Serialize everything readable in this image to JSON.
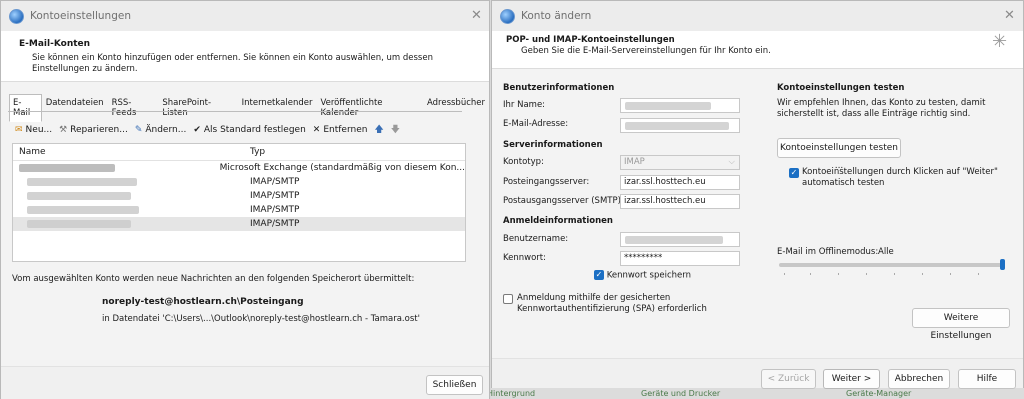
{
  "account_settings": {
    "title": "Kontoeinstellungen",
    "header_title": "E-Mail-Konten",
    "header_desc": "Sie können ein Konto hinzufügen oder entfernen. Sie können ein Konto auswählen, um dessen Einstellungen zu ändern.",
    "tabs": [
      "E-Mail",
      "Datendateien",
      "RSS-Feeds",
      "SharePoint-Listen",
      "Internetkalender",
      "Veröffentlichte Kalender",
      "Adressbücher"
    ],
    "toolbar": {
      "new": "Neu...",
      "repair": "Reparieren...",
      "change": "Ändern...",
      "default": "Als Standard festlegen",
      "remove": "Entfernen"
    },
    "list_headers": {
      "name": "Name",
      "type": "Typ"
    },
    "accounts": [
      {
        "type": "Microsoft Exchange (standardmäßig von diesem Kon..."
      },
      {
        "type": "IMAP/SMTP"
      },
      {
        "type": "IMAP/SMTP"
      },
      {
        "type": "IMAP/SMTP"
      },
      {
        "type": "IMAP/SMTP"
      }
    ],
    "delivery_text": "Vom ausgewählten Konto werden neue Nachrichten an den folgenden Speicherort übermittelt:",
    "delivery_folder": "noreply-test@hostlearn.ch\\Posteingang",
    "delivery_file": "in Datendatei 'C:\\Users\\...\\Outlook\\noreply-test@hostlearn.ch - Tamara.ost'",
    "close_button": "Schließen"
  },
  "change_account": {
    "title": "Konto ändern",
    "header_title": "POP- und IMAP-Kontoeinstellungen",
    "header_desc": "Geben Sie die E-Mail-Servereinstellungen für Ihr Konto ein.",
    "user_info_heading": "Benutzerinformationen",
    "name_label": "Ihr Name:",
    "email_label": "E-Mail-Adresse:",
    "server_info_heading": "Serverinformationen",
    "account_type_label": "Kontotyp:",
    "account_type_value": "IMAP",
    "incoming_label": "Posteingangsserver:",
    "incoming_value": "izar.ssl.hosttech.eu",
    "outgoing_label": "Postausgangsserver (SMTP):",
    "outgoing_value": "izar.ssl.hosttech.eu",
    "login_heading": "Anmeldeinformationen",
    "username_label": "Benutzername:",
    "password_label": "Kennwort:",
    "password_value": "*********",
    "save_password_label": "Kennwort speichern",
    "spa_label_line1": "Anmeldung mithilfe der gesicherten",
    "spa_label_line2": "Kennwortauthentifizierung (SPA) erforderlich",
    "test_heading": "Kontoeinstellungen testen",
    "test_desc": "Wir empfehlen Ihnen, das Konto zu testen, damit sicherstellt ist, dass alle Einträge richtig sind.",
    "test_button": "Kontoeinstellungen testen ...",
    "auto_test_line1": "Kontoeinstellungen durch Klicken auf \"Weiter\"",
    "auto_test_line2": "automatisch testen",
    "offline_label": "E-Mail im Offlinemodus:",
    "offline_value": "Alle",
    "offline_slider_fraction": 1.0,
    "more_settings_button": "Weitere Einstellungen",
    "back_button": "< Zurück",
    "next_button": "Weiter >",
    "cancel_button": "Abbrechen",
    "help_button": "Hilfe"
  },
  "background": {
    "items": [
      "Hintergrund",
      "Geräte und Drucker",
      "Geräte-Manager"
    ]
  },
  "colors": {
    "accent": "#1b6fc4",
    "window_bg": "#f3f3f3",
    "header_bg": "#ffffff"
  }
}
